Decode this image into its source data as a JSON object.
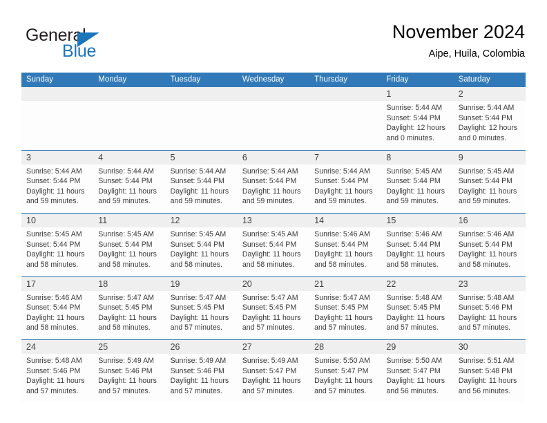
{
  "brand": {
    "name_part1": "General",
    "name_part2": "Blue",
    "accent_color": "#1b75bb"
  },
  "header": {
    "title": "November 2024",
    "subtitle": "Aipe, Huila, Colombia"
  },
  "calendar": {
    "header_color": "#3179b8",
    "weekdays": [
      "Sunday",
      "Monday",
      "Tuesday",
      "Wednesday",
      "Thursday",
      "Friday",
      "Saturday"
    ],
    "weeks": [
      [
        {
          "empty": true
        },
        {
          "empty": true
        },
        {
          "empty": true
        },
        {
          "empty": true
        },
        {
          "empty": true
        },
        {
          "day": "1",
          "sunrise": "Sunrise: 5:44 AM",
          "sunset": "Sunset: 5:44 PM",
          "daylight": "Daylight: 12 hours and 0 minutes."
        },
        {
          "day": "2",
          "sunrise": "Sunrise: 5:44 AM",
          "sunset": "Sunset: 5:44 PM",
          "daylight": "Daylight: 12 hours and 0 minutes."
        }
      ],
      [
        {
          "day": "3",
          "sunrise": "Sunrise: 5:44 AM",
          "sunset": "Sunset: 5:44 PM",
          "daylight": "Daylight: 11 hours and 59 minutes."
        },
        {
          "day": "4",
          "sunrise": "Sunrise: 5:44 AM",
          "sunset": "Sunset: 5:44 PM",
          "daylight": "Daylight: 11 hours and 59 minutes."
        },
        {
          "day": "5",
          "sunrise": "Sunrise: 5:44 AM",
          "sunset": "Sunset: 5:44 PM",
          "daylight": "Daylight: 11 hours and 59 minutes."
        },
        {
          "day": "6",
          "sunrise": "Sunrise: 5:44 AM",
          "sunset": "Sunset: 5:44 PM",
          "daylight": "Daylight: 11 hours and 59 minutes."
        },
        {
          "day": "7",
          "sunrise": "Sunrise: 5:44 AM",
          "sunset": "Sunset: 5:44 PM",
          "daylight": "Daylight: 11 hours and 59 minutes."
        },
        {
          "day": "8",
          "sunrise": "Sunrise: 5:45 AM",
          "sunset": "Sunset: 5:44 PM",
          "daylight": "Daylight: 11 hours and 59 minutes."
        },
        {
          "day": "9",
          "sunrise": "Sunrise: 5:45 AM",
          "sunset": "Sunset: 5:44 PM",
          "daylight": "Daylight: 11 hours and 59 minutes."
        }
      ],
      [
        {
          "day": "10",
          "sunrise": "Sunrise: 5:45 AM",
          "sunset": "Sunset: 5:44 PM",
          "daylight": "Daylight: 11 hours and 58 minutes."
        },
        {
          "day": "11",
          "sunrise": "Sunrise: 5:45 AM",
          "sunset": "Sunset: 5:44 PM",
          "daylight": "Daylight: 11 hours and 58 minutes."
        },
        {
          "day": "12",
          "sunrise": "Sunrise: 5:45 AM",
          "sunset": "Sunset: 5:44 PM",
          "daylight": "Daylight: 11 hours and 58 minutes."
        },
        {
          "day": "13",
          "sunrise": "Sunrise: 5:45 AM",
          "sunset": "Sunset: 5:44 PM",
          "daylight": "Daylight: 11 hours and 58 minutes."
        },
        {
          "day": "14",
          "sunrise": "Sunrise: 5:46 AM",
          "sunset": "Sunset: 5:44 PM",
          "daylight": "Daylight: 11 hours and 58 minutes."
        },
        {
          "day": "15",
          "sunrise": "Sunrise: 5:46 AM",
          "sunset": "Sunset: 5:44 PM",
          "daylight": "Daylight: 11 hours and 58 minutes."
        },
        {
          "day": "16",
          "sunrise": "Sunrise: 5:46 AM",
          "sunset": "Sunset: 5:44 PM",
          "daylight": "Daylight: 11 hours and 58 minutes."
        }
      ],
      [
        {
          "day": "17",
          "sunrise": "Sunrise: 5:46 AM",
          "sunset": "Sunset: 5:44 PM",
          "daylight": "Daylight: 11 hours and 58 minutes."
        },
        {
          "day": "18",
          "sunrise": "Sunrise: 5:47 AM",
          "sunset": "Sunset: 5:45 PM",
          "daylight": "Daylight: 11 hours and 58 minutes."
        },
        {
          "day": "19",
          "sunrise": "Sunrise: 5:47 AM",
          "sunset": "Sunset: 5:45 PM",
          "daylight": "Daylight: 11 hours and 57 minutes."
        },
        {
          "day": "20",
          "sunrise": "Sunrise: 5:47 AM",
          "sunset": "Sunset: 5:45 PM",
          "daylight": "Daylight: 11 hours and 57 minutes."
        },
        {
          "day": "21",
          "sunrise": "Sunrise: 5:47 AM",
          "sunset": "Sunset: 5:45 PM",
          "daylight": "Daylight: 11 hours and 57 minutes."
        },
        {
          "day": "22",
          "sunrise": "Sunrise: 5:48 AM",
          "sunset": "Sunset: 5:45 PM",
          "daylight": "Daylight: 11 hours and 57 minutes."
        },
        {
          "day": "23",
          "sunrise": "Sunrise: 5:48 AM",
          "sunset": "Sunset: 5:46 PM",
          "daylight": "Daylight: 11 hours and 57 minutes."
        }
      ],
      [
        {
          "day": "24",
          "sunrise": "Sunrise: 5:48 AM",
          "sunset": "Sunset: 5:46 PM",
          "daylight": "Daylight: 11 hours and 57 minutes."
        },
        {
          "day": "25",
          "sunrise": "Sunrise: 5:49 AM",
          "sunset": "Sunset: 5:46 PM",
          "daylight": "Daylight: 11 hours and 57 minutes."
        },
        {
          "day": "26",
          "sunrise": "Sunrise: 5:49 AM",
          "sunset": "Sunset: 5:46 PM",
          "daylight": "Daylight: 11 hours and 57 minutes."
        },
        {
          "day": "27",
          "sunrise": "Sunrise: 5:49 AM",
          "sunset": "Sunset: 5:47 PM",
          "daylight": "Daylight: 11 hours and 57 minutes."
        },
        {
          "day": "28",
          "sunrise": "Sunrise: 5:50 AM",
          "sunset": "Sunset: 5:47 PM",
          "daylight": "Daylight: 11 hours and 57 minutes."
        },
        {
          "day": "29",
          "sunrise": "Sunrise: 5:50 AM",
          "sunset": "Sunset: 5:47 PM",
          "daylight": "Daylight: 11 hours and 56 minutes."
        },
        {
          "day": "30",
          "sunrise": "Sunrise: 5:51 AM",
          "sunset": "Sunset: 5:48 PM",
          "daylight": "Daylight: 11 hours and 56 minutes."
        }
      ]
    ]
  }
}
